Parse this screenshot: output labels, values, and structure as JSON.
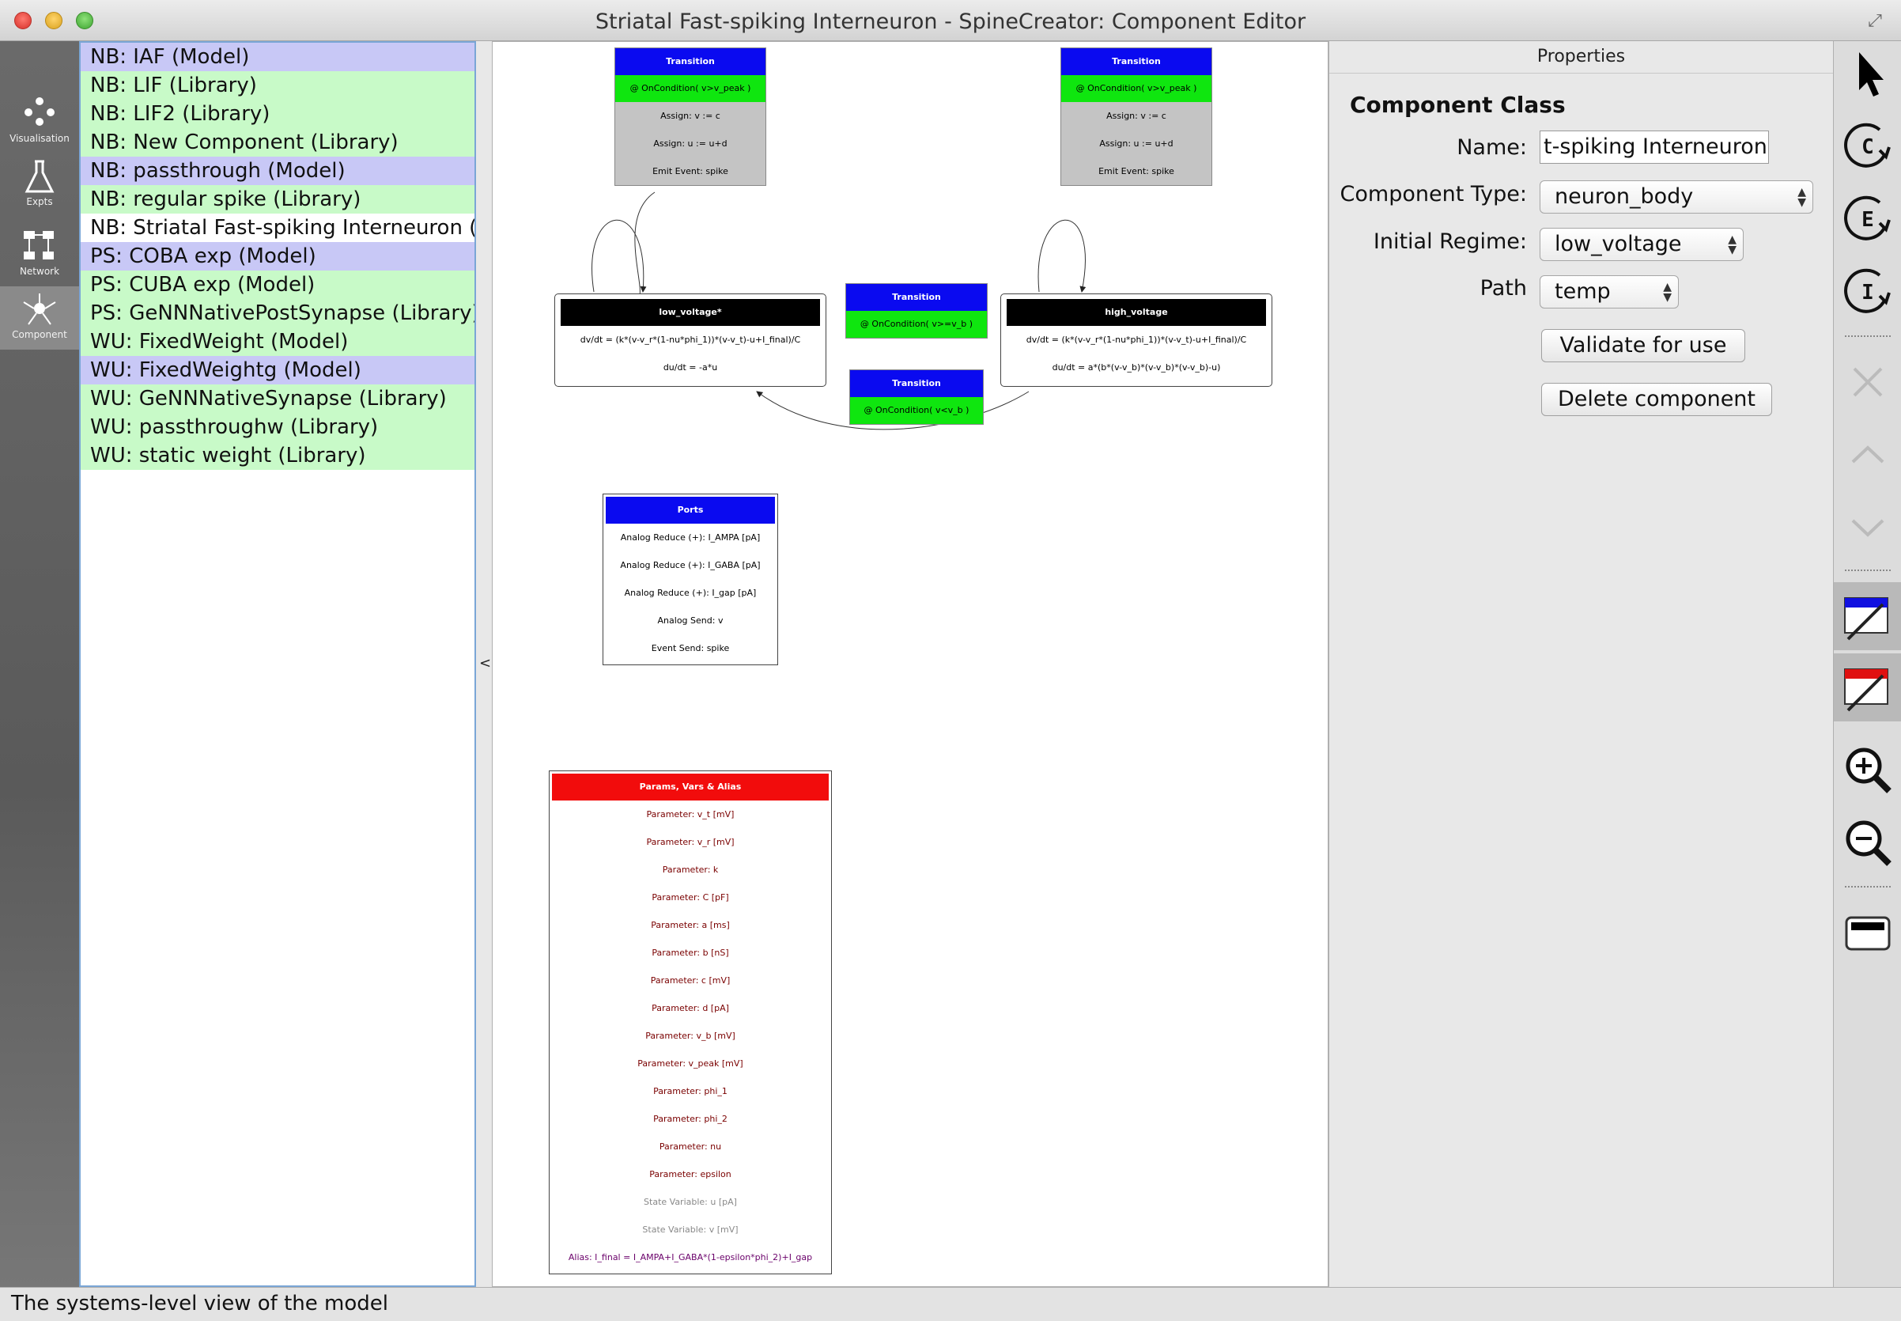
{
  "window": {
    "title": "Striatal Fast-spiking Interneuron - SpineCreator: Component Editor",
    "fullscreen_glyph": "⤢"
  },
  "modes": [
    {
      "label": "Visualisation",
      "icon": "visualisation-icon"
    },
    {
      "label": "Expts",
      "icon": "flask-icon"
    },
    {
      "label": "Network",
      "icon": "network-icon"
    },
    {
      "label": "Component",
      "icon": "neuron-icon",
      "active": true
    }
  ],
  "component_list": [
    {
      "label": "NB: IAF (Model)",
      "kind": "model"
    },
    {
      "label": "NB: LIF (Library)",
      "kind": "library"
    },
    {
      "label": "NB: LIF2 (Library)",
      "kind": "library"
    },
    {
      "label": "NB: New Component (Library)",
      "kind": "library"
    },
    {
      "label": "NB: passthrough (Model)",
      "kind": "model"
    },
    {
      "label": "NB: regular spike (Library)",
      "kind": "library"
    },
    {
      "label": "NB: Striatal Fast-spiking Interneuron (/",
      "kind": "selected"
    },
    {
      "label": "PS: COBA exp (Model)",
      "kind": "model"
    },
    {
      "label": "PS: CUBA exp (Model)",
      "kind": "library"
    },
    {
      "label": "PS: GeNNNativePostSynapse (Library)",
      "kind": "library"
    },
    {
      "label": "WU: FixedWeight (Model)",
      "kind": "library"
    },
    {
      "label": "WU: FixedWeightg (Model)",
      "kind": "model"
    },
    {
      "label": "WU: GeNNNativeSynapse (Library)",
      "kind": "library"
    },
    {
      "label": "WU: passthroughw (Library)",
      "kind": "library"
    },
    {
      "label": "WU: static weight (Library)",
      "kind": "library"
    }
  ],
  "collapse_handle": "<",
  "diagram": {
    "transition_top_left": {
      "title": "Transition",
      "condition": "@ OnCondition( v>v_peak )",
      "rows": [
        "Assign: v := c",
        "Assign: u := u+d",
        "Emit Event: spike"
      ]
    },
    "transition_top_right": {
      "title": "Transition",
      "condition": "@ OnCondition( v>v_peak )",
      "rows": [
        "Assign: v := c",
        "Assign: u := u+d",
        "Emit Event: spike"
      ]
    },
    "transition_mid_upper": {
      "title": "Transition",
      "condition": "@ OnCondition( v>=v_b )"
    },
    "transition_mid_lower": {
      "title": "Transition",
      "condition": "@ OnCondition( v<v_b )"
    },
    "regime_low": {
      "title": "low_voltage*",
      "rows": [
        "dv/dt = (k*(v-v_r*(1-nu*phi_1))*(v-v_t)-u+I_final)/C",
        "du/dt = -a*u"
      ]
    },
    "regime_high": {
      "title": "high_voltage",
      "rows": [
        "dv/dt = (k*(v-v_r*(1-nu*phi_1))*(v-v_t)-u+I_final)/C",
        "du/dt = a*(b*(v-v_b)*(v-v_b)*(v-v_b)-u)"
      ]
    },
    "ports": {
      "title": "Ports",
      "rows": [
        "Analog Reduce (+): I_AMPA [pA]",
        "Analog Reduce (+): I_GABA [pA]",
        "Analog Reduce (+): I_gap [pA]",
        "Analog Send: v",
        "Event Send: spike"
      ]
    },
    "params": {
      "title": "Params, Vars & Alias",
      "parameters": [
        "Parameter: v_t [mV]",
        "Parameter: v_r [mV]",
        "Parameter: k",
        "Parameter: C [pF]",
        "Parameter: a [ms]",
        "Parameter: b [nS]",
        "Parameter: c [mV]",
        "Parameter: d [pA]",
        "Parameter: v_b [mV]",
        "Parameter: v_peak [mV]",
        "Parameter: phi_1",
        "Parameter: phi_2",
        "Parameter: nu",
        "Parameter: epsilon"
      ],
      "state_variables": [
        "State Variable: u [pA]",
        "State Variable: v [mV]"
      ],
      "aliases": [
        "Alias: I_final = I_AMPA+I_GABA*(1-epsilon*phi_2)+I_gap"
      ]
    }
  },
  "properties": {
    "header": "Properties",
    "heading": "Component Class",
    "name_label": "Name:",
    "name_value": "t-spiking Interneuron",
    "type_label": "Component Type:",
    "type_value": "neuron_body",
    "regime_label": "Initial Regime:",
    "regime_value": "low_voltage",
    "path_label": "Path",
    "path_value": "temp",
    "validate_label": "Validate for use",
    "delete_label": "Delete component",
    "select_arrows": "▲\n▼"
  },
  "tools": [
    {
      "name": "pointer-tool-icon"
    },
    {
      "name": "add-constant-icon",
      "glyph": "C"
    },
    {
      "name": "add-event-icon",
      "glyph": "E"
    },
    {
      "name": "add-impulse-icon",
      "glyph": "I"
    },
    {
      "name": "delete-icon"
    },
    {
      "name": "move-up-icon"
    },
    {
      "name": "move-down-icon"
    },
    {
      "name": "add-port-icon"
    },
    {
      "name": "add-param-icon",
      "glyph": "Port"
    },
    {
      "name": "zoom-in-icon"
    },
    {
      "name": "zoom-out-icon"
    },
    {
      "name": "add-regime-icon",
      "glyph": "Regime"
    }
  ],
  "status": "The systems-level view of the model",
  "colors": {
    "transition_header": "#0a0af0",
    "condition": "#0fe60f",
    "params_header": "#f20c0c",
    "model_row": "#c8c8f6",
    "library_row": "#c8fac8"
  }
}
